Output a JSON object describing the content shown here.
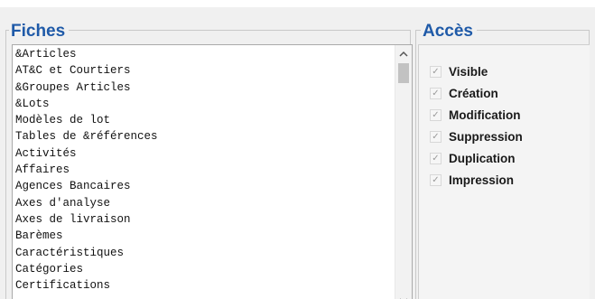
{
  "fiches": {
    "title": "Fiches",
    "items": [
      "&Articles",
      "AT&C et Courtiers",
      "&Groupes Articles",
      "&Lots",
      "Modèles de lot",
      "Tables de &références",
      "Activités",
      "Affaires",
      "Agences Bancaires",
      "Axes d'analyse",
      "Axes de livraison",
      "Barèmes",
      "Caractéristiques",
      "Catégories",
      "Certifications"
    ],
    "scroll_up_icon": "chevron-up-icon",
    "scroll_down_icon": "chevron-down-icon"
  },
  "acces": {
    "title": "Accès",
    "checkboxes": [
      {
        "label": "Visible",
        "checked": true
      },
      {
        "label": "Création",
        "checked": true
      },
      {
        "label": "Modification",
        "checked": true
      },
      {
        "label": "Suppression",
        "checked": true
      },
      {
        "label": "Duplication",
        "checked": true
      },
      {
        "label": "Impression",
        "checked": true
      }
    ]
  },
  "colors": {
    "group_title": "#1f5aa8",
    "window_bg": "#f0f0f0"
  }
}
